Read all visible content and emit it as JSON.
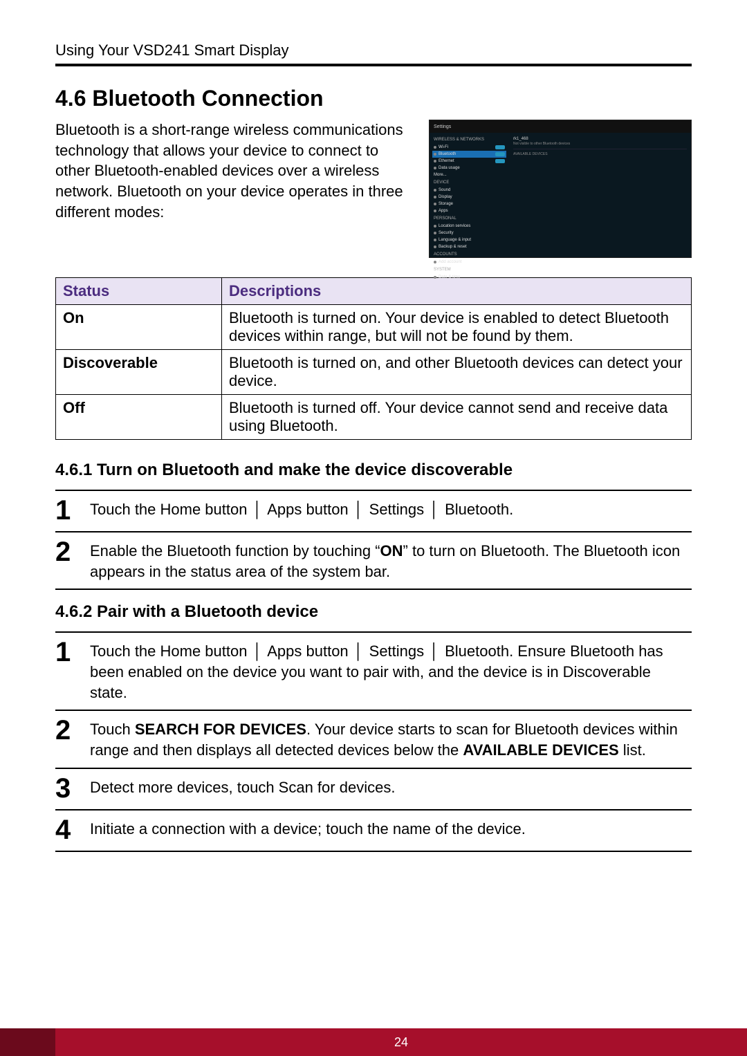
{
  "header": "Using Your VSD241 Smart Display",
  "section_title": "4.6  Bluetooth Connection",
  "intro": "Bluetooth is a short-range wireless communications technology that allows your device to connect to other Bluetooth-enabled devices over a wireless network. Bluetooth on your device operates in three different modes:",
  "screenshot": {
    "topbar": "Settings",
    "sb_header1": "WIRELESS & NETWORKS",
    "items1": [
      {
        "label": "Wi-Fi",
        "toggle": true
      },
      {
        "label": "Bluetooth",
        "toggle": true,
        "selected": true
      },
      {
        "label": "Ethernet",
        "toggle": true
      },
      {
        "label": "Data usage"
      },
      {
        "label": "More..."
      }
    ],
    "sb_header2": "DEVICE",
    "items2": [
      {
        "label": "Sound"
      },
      {
        "label": "Display"
      },
      {
        "label": "Storage"
      },
      {
        "label": "Apps"
      }
    ],
    "sb_header3": "PERSONAL",
    "items3": [
      {
        "label": "Location services"
      },
      {
        "label": "Security"
      },
      {
        "label": "Language & input"
      },
      {
        "label": "Backup & reset"
      }
    ],
    "sb_header4": "ACCOUNTS",
    "items4": [
      {
        "label": "Add account"
      }
    ],
    "sb_header5": "SYSTEM",
    "items5": [
      {
        "label": "Date & time"
      }
    ],
    "content_device": "rk1_468",
    "content_sub": "Not visible to other Bluetooth devices",
    "content_avail": "AVAILABLE DEVICES"
  },
  "table": {
    "hdr_status": "Status",
    "hdr_desc": "Descriptions",
    "rows": [
      {
        "status": "On",
        "desc": "Bluetooth is turned on. Your device is enabled to detect Bluetooth devices within range, but will not be found by them."
      },
      {
        "status": "Discoverable",
        "desc": "Bluetooth is turned on, and other Bluetooth devices can detect your device."
      },
      {
        "status": "Off",
        "desc": "Bluetooth is turned off. Your device cannot send and receive data using Bluetooth."
      }
    ]
  },
  "sub1": {
    "title": "4.6.1  Turn on Bluetooth and make the device discoverable",
    "steps": {
      "s1": {
        "pre": "Touch the Home button ",
        "seg1": " Apps button ",
        "seg2": " Settings ",
        "seg3": " Bluetooth."
      },
      "s2": {
        "pre": "Enable the Bluetooth function by touching “",
        "bold": "ON",
        "post": "” to turn on Bluetooth. The Bluetooth icon appears in the status area of the system bar."
      }
    }
  },
  "sub2": {
    "title": "4.6.2  Pair with a Bluetooth device",
    "steps": {
      "s1": {
        "pre": "Touch the Home button ",
        "seg1": " Apps button ",
        "seg2": " Settings ",
        "seg3": " Bluetooth. Ensure Bluetooth has been enabled on the device you want to pair with, and the device is in Discoverable state."
      },
      "s2": {
        "pre": "Touch ",
        "b1": "SEARCH FOR DEVICES",
        "mid": ". Your device starts to scan for Bluetooth devices within range and then displays all detected devices below the ",
        "b2": "AVAILABLE DEVICES",
        "post": " list."
      },
      "s3": "Detect more devices, touch Scan for devices.",
      "s4": "Initiate a connection with a device; touch the name of the device."
    }
  },
  "nums": {
    "n1": "1",
    "n2": "2",
    "n3": "3",
    "n4": "4"
  },
  "sep": "│",
  "page_number": "24"
}
